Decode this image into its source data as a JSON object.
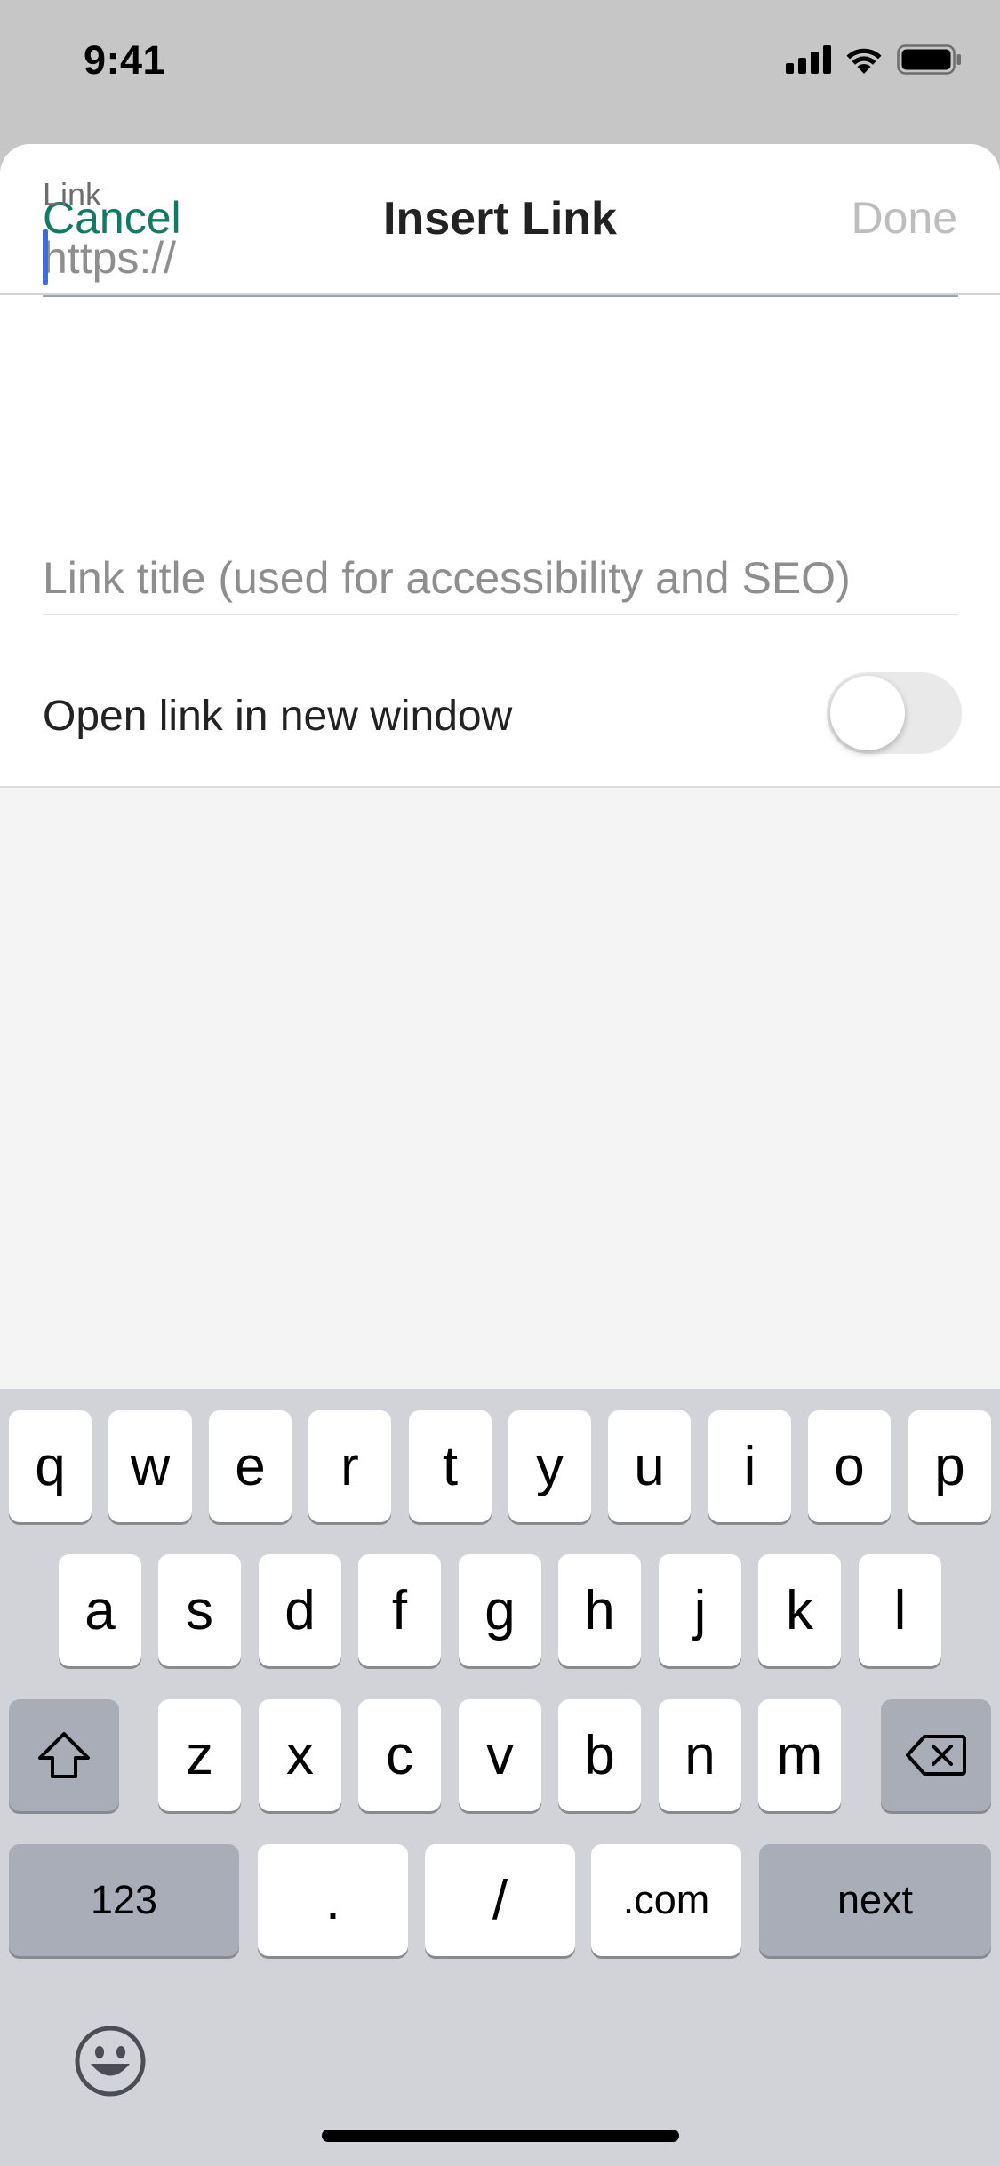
{
  "status_bar": {
    "time": "9:41"
  },
  "nav": {
    "cancel": "Cancel",
    "title": "Insert Link",
    "done": "Done"
  },
  "form": {
    "link_label": "Link",
    "link_value": "",
    "link_placeholder": "https://",
    "title_value": "",
    "title_placeholder": "Link title (used for accessibility and SEO)",
    "new_window_label": "Open link in new window",
    "new_window_on": false
  },
  "keyboard": {
    "row1": [
      "q",
      "w",
      "e",
      "r",
      "t",
      "y",
      "u",
      "i",
      "o",
      "p"
    ],
    "row2": [
      "a",
      "s",
      "d",
      "f",
      "g",
      "h",
      "j",
      "k",
      "l"
    ],
    "row3": [
      "z",
      "x",
      "c",
      "v",
      "b",
      "n",
      "m"
    ],
    "numbers_key": "123",
    "dot_key": ".",
    "slash_key": "/",
    "com_key": ".com",
    "next_key": "next"
  },
  "colors": {
    "accent": "#117a64",
    "done_disabled": "#bdbdbd",
    "caret": "#3d6dd8"
  }
}
